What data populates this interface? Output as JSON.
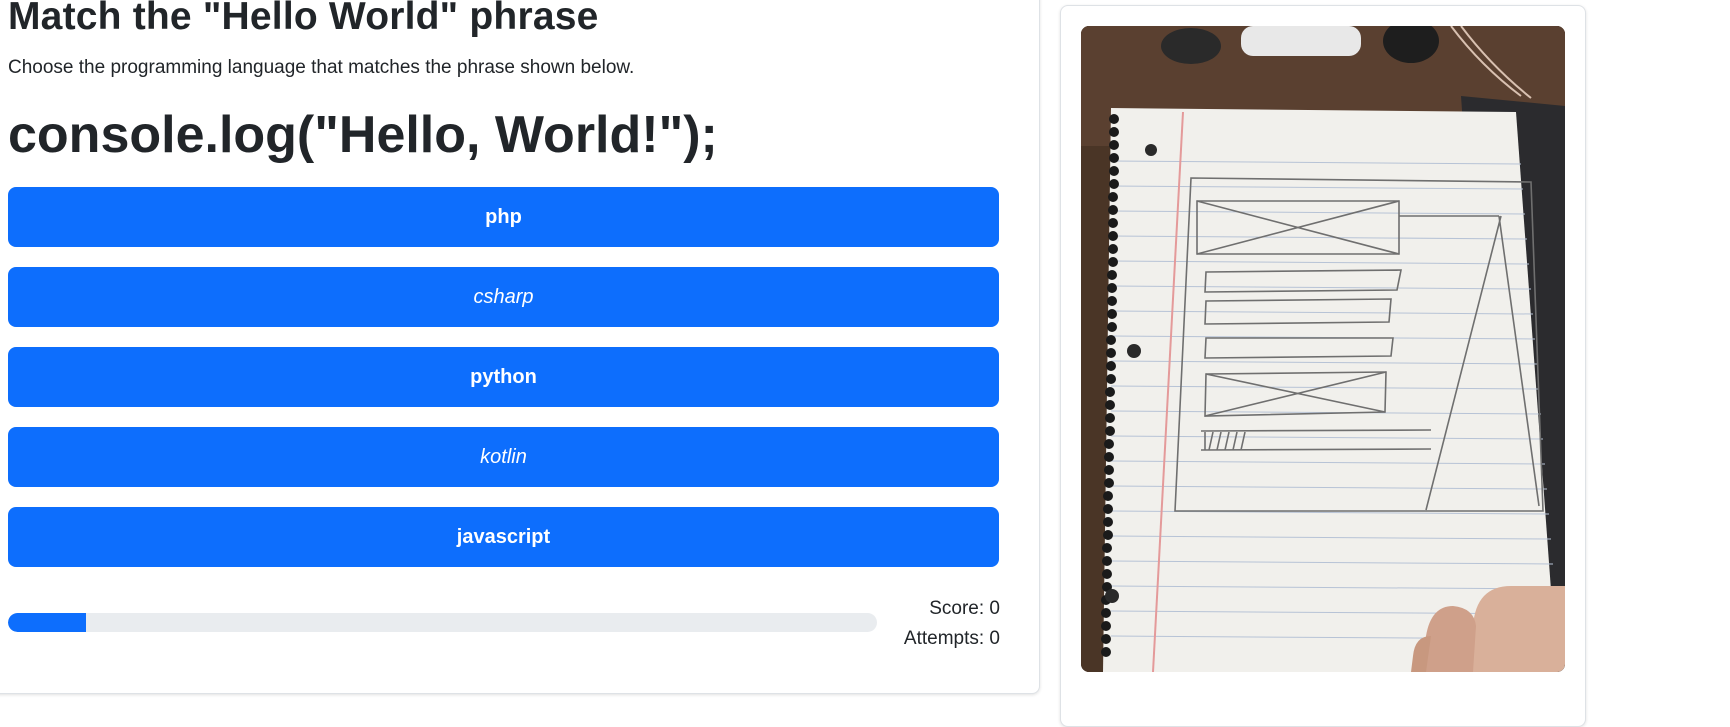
{
  "quiz": {
    "title": "Match the \"Hello World\" phrase",
    "instructions": "Choose the programming language that matches the phrase shown below.",
    "phrase": "console.log(\"Hello, World!\");",
    "choices": [
      {
        "label": "php",
        "style": "bold"
      },
      {
        "label": "csharp",
        "style": "italic"
      },
      {
        "label": "python",
        "style": "bold"
      },
      {
        "label": "kotlin",
        "style": "italic"
      },
      {
        "label": "javascript",
        "style": "bold"
      }
    ],
    "progress_fraction": 0.09,
    "score_text": "Score: 0",
    "attempts_text": "Attempts: 0"
  },
  "image": {
    "subject": "photo of a hand-drawn wireframe sketch on a spiral notebook",
    "icon": "notebook-sketch-photo"
  },
  "colors": {
    "primary": "#0d6efd",
    "track": "#e9ecef",
    "text": "#212529",
    "border": "#dee2e6"
  }
}
